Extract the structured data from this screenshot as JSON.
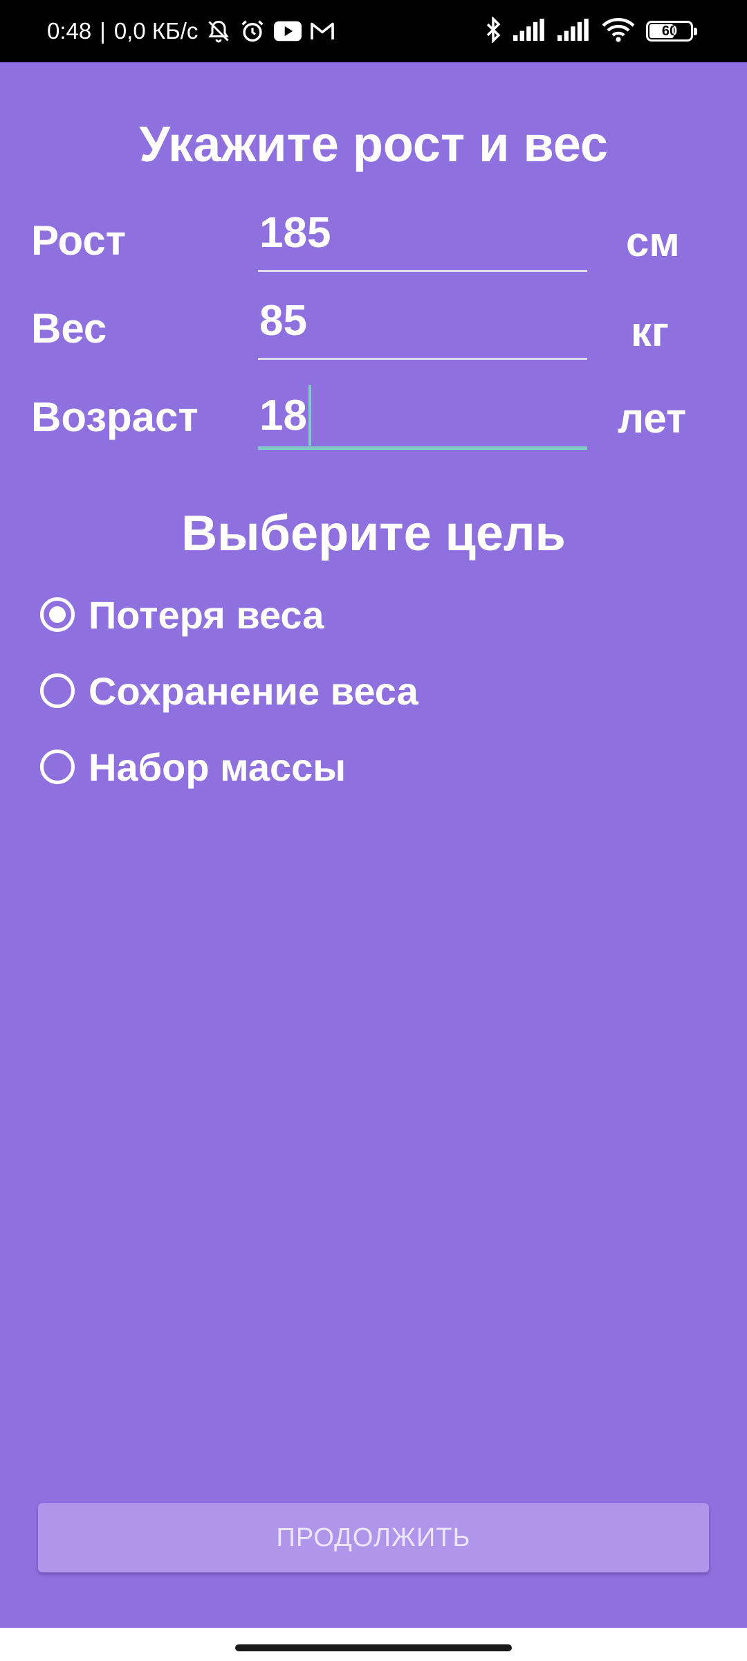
{
  "status_bar": {
    "time": "0:48",
    "separator": "|",
    "network_speed": "0,0 КБ/с",
    "left_icons": [
      "bell-off-icon",
      "alarm-icon",
      "youtube-icon",
      "gmail-icon"
    ],
    "right_icons": [
      "bluetooth-icon",
      "signal-icon",
      "signal-icon",
      "wifi-icon",
      "battery-icon"
    ],
    "battery_level": "60"
  },
  "form": {
    "title": "Укажите рост и вес",
    "height": {
      "label": "Рост",
      "value": "185",
      "unit": "см"
    },
    "weight": {
      "label": "Вес",
      "value": "85",
      "unit": "кг"
    },
    "age": {
      "label": "Возраст",
      "value": "18",
      "unit": "лет"
    }
  },
  "goal": {
    "title": "Выберите цель",
    "options": [
      {
        "label": "Потеря веса",
        "checked": true
      },
      {
        "label": "Сохранение веса",
        "checked": false
      },
      {
        "label": "Набор массы",
        "checked": false
      }
    ]
  },
  "continue_button": {
    "label": "ПРОДОЛЖИТЬ"
  },
  "colors": {
    "background": "#8e70df",
    "button": "#b096ea",
    "focus_accent": "#80cbc4",
    "text": "#ffffff"
  }
}
